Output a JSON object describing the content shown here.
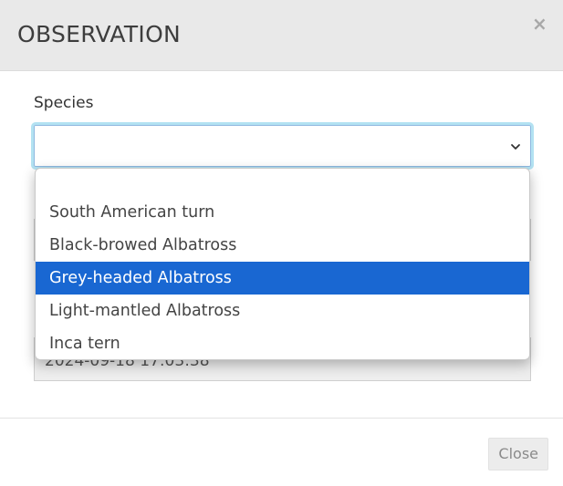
{
  "modal": {
    "title": "OBSERVATION",
    "close_icon": "×"
  },
  "species": {
    "label": "Species",
    "value": "",
    "options": [
      "",
      "South American turn",
      "Black-browed Albatross",
      "Grey-headed Albatross",
      "Light-mantled Albatross",
      "Inca tern"
    ],
    "highlighted_index": 3,
    "highlight_color": "#1967d2"
  },
  "date": {
    "value": "2024-09-18 17:03:38"
  },
  "footer": {
    "close_label": "Close"
  },
  "icons": {
    "close": "close-icon",
    "dropdown": "chevron-down-icon"
  }
}
